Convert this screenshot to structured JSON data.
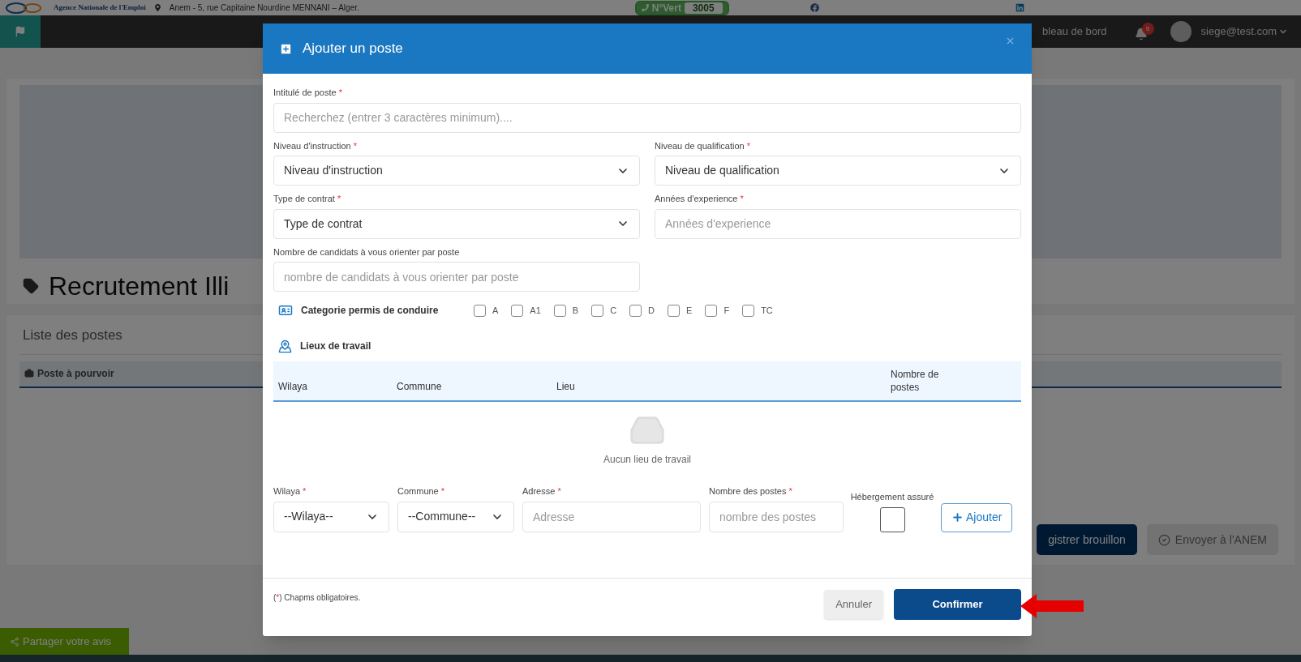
{
  "top_strip": {
    "logo_text": "Agence Nationale de l'Emploi",
    "address": "Anem - 5, rue Capitaine Nourdine MENNANI – Alger.",
    "hotline_label": "N°Vert",
    "hotline_number": "3005"
  },
  "navbar": {
    "link": "bleau de bord",
    "notification_count": "9",
    "user": "siege@test.com"
  },
  "page": {
    "title": "Recrutement Illi",
    "list_title": "Liste des postes",
    "table_header": "Poste à pourvoir",
    "buttons": [
      {
        "label": "gistrer brouillon",
        "disabled": false
      },
      {
        "label": "Envoyer à l'ANEM",
        "disabled": true
      }
    ]
  },
  "feedback_button": "Partager votre avis",
  "modal": {
    "title": "Ajouter un poste",
    "rows": [
      [
        {
          "kind": "search",
          "label": "Intitulé de poste",
          "mark": "*",
          "placeholder": "Recherchez (entrer 3 caractères minimum)...."
        }
      ],
      [
        {
          "kind": "select",
          "label": "Niveau d'instruction",
          "mark": "*",
          "value": "Niveau d'instruction"
        },
        {
          "kind": "select",
          "label": "Niveau de qualification",
          "mark": "*",
          "value": "Niveau de qualification"
        }
      ],
      [
        {
          "kind": "select",
          "label": "Type de contrat",
          "mark": "*",
          "value": "Type de contrat"
        },
        {
          "kind": "input",
          "label": "Années d'experience",
          "mark": "*",
          "placeholder": "Années d'experience"
        }
      ],
      [
        {
          "kind": "input",
          "label": "Nombre de candidats à vous orienter par poste",
          "placeholder": "nombre de candidats à vous orienter par poste"
        }
      ]
    ],
    "license": {
      "title": "Categorie permis de conduire",
      "categories": [
        {
          "label": "A",
          "checked": false
        },
        {
          "label": "A1",
          "checked": false
        },
        {
          "label": "B",
          "checked": false
        },
        {
          "label": "C",
          "checked": false
        },
        {
          "label": "D",
          "checked": false
        },
        {
          "label": "E",
          "checked": false
        },
        {
          "label": "F",
          "checked": false
        },
        {
          "label": "TC",
          "checked": false
        }
      ]
    },
    "workplaces": {
      "title": "Lieux de travail",
      "columns": [
        "Wilaya",
        "Commune",
        "Lieu",
        "Nombre de postes"
      ],
      "empty_text": "Aucun lieu de travail",
      "form": [
        {
          "kind": "select",
          "label": "Wilaya",
          "mark": "*",
          "value": "--Wilaya--"
        },
        {
          "kind": "select",
          "label": "Commune",
          "mark": "*",
          "value": "--Commune--"
        },
        {
          "kind": "input",
          "label": "Adresse",
          "mark": "*",
          "placeholder": "Adresse"
        },
        {
          "kind": "input",
          "label": "Nombre des postes",
          "mark": "*",
          "placeholder": "nombre des postes"
        },
        {
          "kind": "checkbox",
          "label": "Hébergement assuré",
          "checked": false
        }
      ],
      "add_button": "Ajouter"
    },
    "note": {
      "open": "(",
      "mark": "*",
      "rest": ") Chapms obligatoires."
    },
    "cancel_button": "Annuler",
    "confirm_button": "Confirmer"
  }
}
